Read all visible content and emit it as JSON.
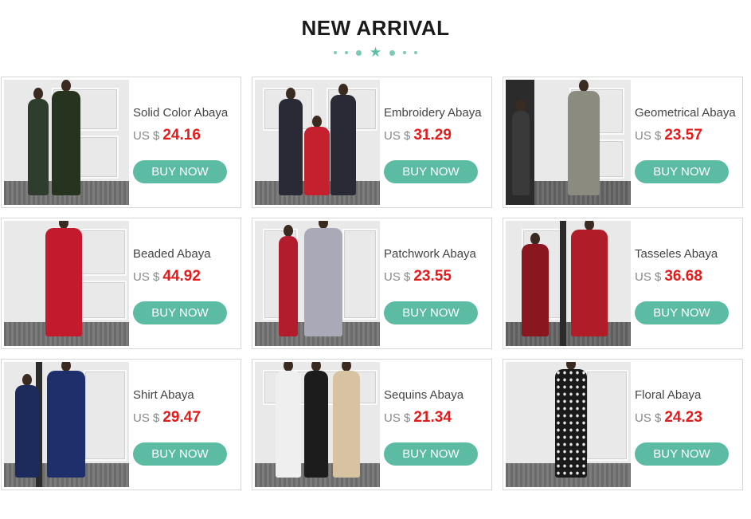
{
  "section": {
    "title": "NEW ARRIVAL"
  },
  "colors": {
    "accent": "#5bbba3",
    "price": "#e31b1b"
  },
  "products": [
    {
      "name": "Solid Color Abaya",
      "currency": "US $",
      "price": "24.16",
      "button": "BUY NOW",
      "outfit_color": "#2f3d2e",
      "outfit_color2": "#26331f"
    },
    {
      "name": "Embroidery Abaya",
      "currency": "US $",
      "price": "31.29",
      "button": "BUY NOW",
      "outfit_color": "#2a2a36",
      "outfit_color2": "#c4202e"
    },
    {
      "name": "Geometrical Abaya",
      "currency": "US $",
      "price": "23.57",
      "button": "BUY NOW",
      "outfit_color": "#3a3a3a",
      "outfit_color2": "#8b8b80"
    },
    {
      "name": "Beaded Abaya",
      "currency": "US $",
      "price": "44.92",
      "button": "BUY NOW",
      "outfit_color": "#c41a2e",
      "outfit_color2": "#c41a2e"
    },
    {
      "name": "Patchwork Abaya",
      "currency": "US $",
      "price": "23.55",
      "button": "BUY NOW",
      "outfit_color": "#a9a9b8",
      "outfit_color2": "#b31c2c"
    },
    {
      "name": "Tasseles Abaya",
      "currency": "US $",
      "price": "36.68",
      "button": "BUY NOW",
      "outfit_color": "#8a1620",
      "outfit_color2": "#b01c27"
    },
    {
      "name": "Shirt Abaya",
      "currency": "US $",
      "price": "29.47",
      "button": "BUY NOW",
      "outfit_color": "#1c2a5c",
      "outfit_color2": "#1e2f6b"
    },
    {
      "name": "Sequins Abaya",
      "currency": "US $",
      "price": "21.34",
      "button": "BUY NOW",
      "outfit_color": "#efefef",
      "outfit_color2": "#d7c3a2"
    },
    {
      "name": "Floral Abaya",
      "currency": "US $",
      "price": "24.23",
      "button": "BUY NOW",
      "outfit_color": "#1a1a1a",
      "outfit_color2": "#1a1a1a"
    }
  ]
}
